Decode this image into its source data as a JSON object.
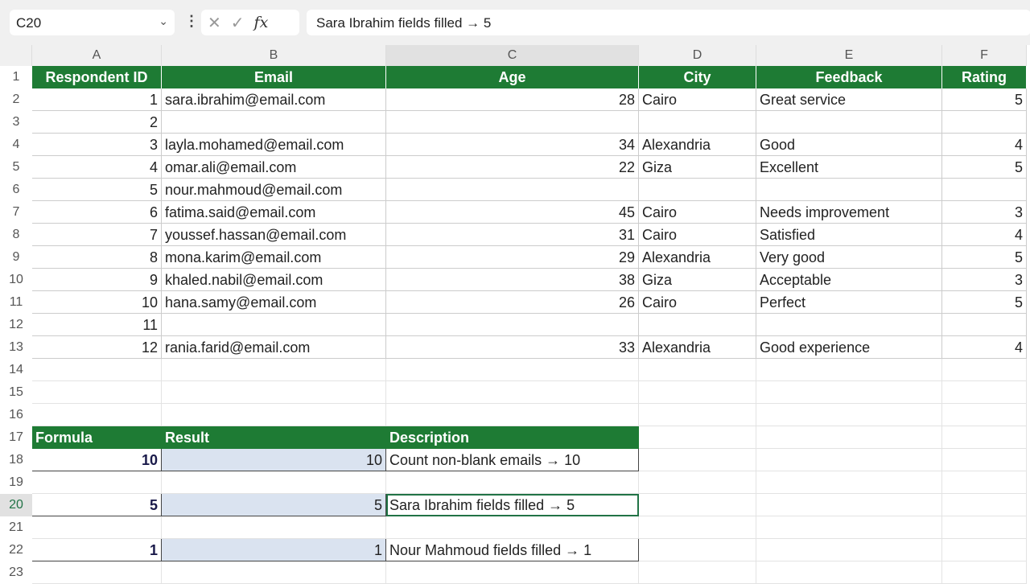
{
  "formula_bar": {
    "name_box": "C20",
    "formula": "Sara Ibrahim fields filled → 5"
  },
  "columns": [
    "A",
    "B",
    "C",
    "D",
    "E",
    "F"
  ],
  "headers": [
    "Respondent ID",
    "Email",
    "Age",
    "City",
    "Feedback",
    "Rating"
  ],
  "rows": [
    [
      "1",
      "sara.ibrahim@email.com",
      "28",
      "Cairo",
      "Great service",
      "5"
    ],
    [
      "2",
      "",
      "",
      "",
      "",
      ""
    ],
    [
      "3",
      "layla.mohamed@email.com",
      "34",
      "Alexandria",
      "Good",
      "4"
    ],
    [
      "4",
      "omar.ali@email.com",
      "22",
      "Giza",
      "Excellent",
      "5"
    ],
    [
      "5",
      "nour.mahmoud@email.com",
      "",
      "",
      "",
      ""
    ],
    [
      "6",
      "fatima.said@email.com",
      "45",
      "Cairo",
      "Needs improvement",
      "3"
    ],
    [
      "7",
      "youssef.hassan@email.com",
      "31",
      "Cairo",
      "Satisfied",
      "4"
    ],
    [
      "8",
      "mona.karim@email.com",
      "29",
      "Alexandria",
      "Very good",
      "5"
    ],
    [
      "9",
      "khaled.nabil@email.com",
      "38",
      "Giza",
      "Acceptable",
      "3"
    ],
    [
      "10",
      "hana.samy@email.com",
      "26",
      "Cairo",
      "Perfect",
      "5"
    ],
    [
      "11",
      "",
      "",
      "",
      "",
      ""
    ],
    [
      "12",
      "rania.farid@email.com",
      "33",
      "Alexandria",
      "Good experience",
      "4"
    ]
  ],
  "summary_headers": [
    "Formula",
    "Result",
    "Description"
  ],
  "summary": [
    {
      "row": 18,
      "formula": "10",
      "result": "10",
      "description": "Count non-blank emails → 10"
    },
    {
      "row": 20,
      "formula": "5",
      "result": "5",
      "description": "Sara Ibrahim fields filled → 5"
    },
    {
      "row": 22,
      "formula": "1",
      "result": "1",
      "description": "Nour Mahmoud fields filled → 1"
    }
  ]
}
